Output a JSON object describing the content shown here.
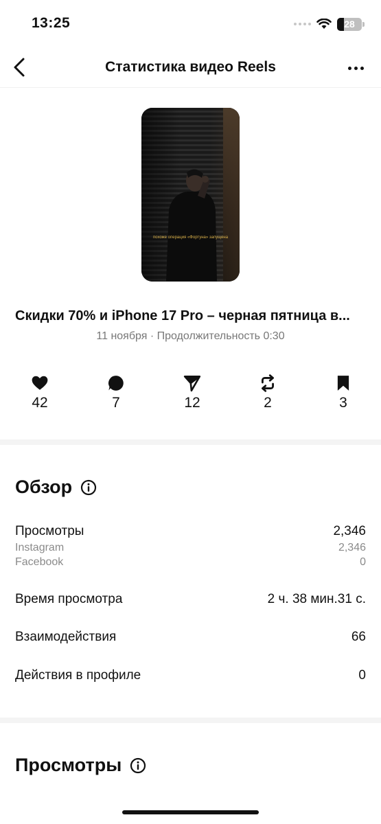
{
  "status_bar": {
    "time": "13:25",
    "battery": "28",
    "battery_level": 0.28
  },
  "header": {
    "title": "Статистика видео Reels"
  },
  "video": {
    "thumbnail_caption": "похоже операция «Фортуна» запущена",
    "title": "Скидки 70% и iPhone 17 Pro –  черная пятница в...",
    "meta": "11 ноября · Продолжительность 0:30"
  },
  "stats": {
    "likes": "42",
    "comments": "7",
    "shares": "12",
    "reposts": "2",
    "saves": "3"
  },
  "overview": {
    "title": "Обзор",
    "views_label": "Просмотры",
    "views_value": "2,346",
    "instagram_label": "Instagram",
    "instagram_value": "2,346",
    "facebook_label": "Facebook",
    "facebook_value": "0",
    "watch_time_label": "Время просмотра",
    "watch_time_value": "2 ч. 38 мин.31 с.",
    "interactions_label": "Взаимодействия",
    "interactions_value": "66",
    "profile_actions_label": "Действия в профиле",
    "profile_actions_value": "0"
  },
  "views_section": {
    "title": "Просмотры"
  },
  "icons": {
    "back": "chevron-left-icon",
    "more": "more-horizontal-icon",
    "like": "heart-icon",
    "comment": "comment-icon",
    "share": "send-icon",
    "repost": "repost-icon",
    "save": "bookmark-icon",
    "info": "info-icon"
  }
}
